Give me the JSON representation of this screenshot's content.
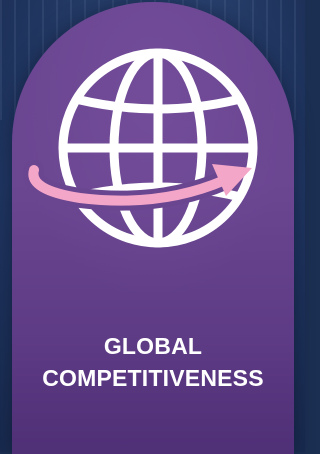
{
  "badge": {
    "title_line1": "GLOBAL",
    "title_line2": "COMPETITIVENESS"
  },
  "icon": {
    "name": "globe-with-arrow-icon"
  },
  "colors": {
    "card": "#6a4590",
    "globe": "#ffffff",
    "arrow": "#f4a6c8",
    "background": "#243e6a"
  }
}
